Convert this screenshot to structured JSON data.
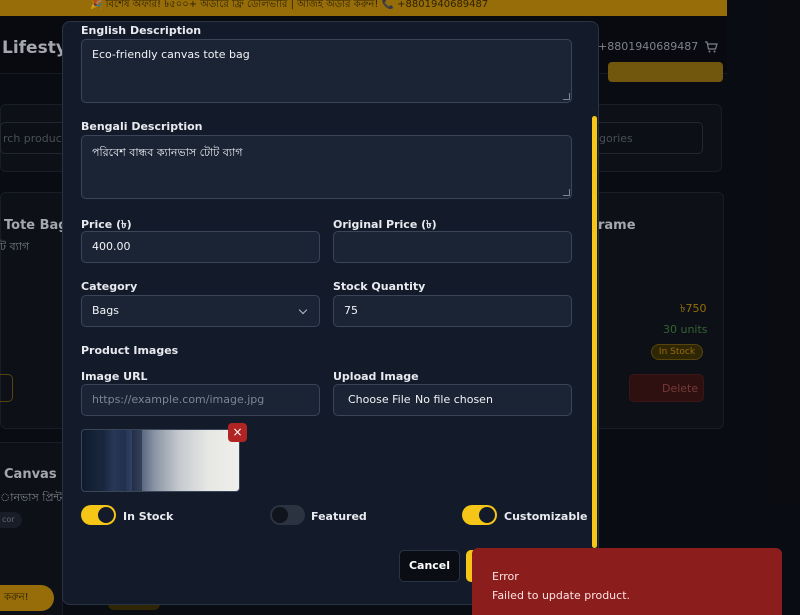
{
  "background": {
    "promo_text": "🎉 বিশেষ অফার! ৳৫০০+ অর্ডারে ফ্রি ডেলিভারি | আজই অর্ডার করুন! 📞 +8801940689487",
    "brand": "Lifesty",
    "header_phone": "+8801940689487",
    "search_placeholder": "rch products",
    "category_select": "gories",
    "card1_title": "Tote Bag",
    "card1_subtitle": "ট ব্যাগ",
    "card2_title": "rame",
    "card2_price": "৳750",
    "card2_units": "30 units",
    "card2_badge": "In Stock",
    "card2_delete": "Delete",
    "card3_title": "Canvas P",
    "card3_subtitle": "ানভাস প্রিন্ট",
    "card3_tag": "cor",
    "cta_text": "করুন!"
  },
  "form": {
    "english_description": {
      "label": "English Description",
      "value": "Eco-friendly canvas tote bag"
    },
    "bengali_description": {
      "label": "Bengali Description",
      "value": "পরিবেশ বান্ধব ক্যানভাস টোট ব্যাগ"
    },
    "price": {
      "label": "Price (৳)",
      "value": "400.00"
    },
    "original_price": {
      "label": "Original Price (৳)",
      "value": ""
    },
    "category": {
      "label": "Category",
      "value": "Bags"
    },
    "stock_quantity": {
      "label": "Stock Quantity",
      "value": "75"
    },
    "product_images": {
      "label": "Product Images"
    },
    "image_url": {
      "label": "Image URL",
      "placeholder": "https://example.com/image.jpg"
    },
    "upload_image": {
      "label": "Upload Image",
      "button": "Choose File",
      "status": "No file chosen"
    },
    "remove_image": "×",
    "toggles": [
      {
        "label": "In Stock",
        "on": true
      },
      {
        "label": "Featured",
        "on": false
      },
      {
        "label": "Customizable",
        "on": true
      }
    ],
    "cancel_label": "Cancel"
  },
  "toast": {
    "title": "Error",
    "message": "Failed to update product."
  },
  "colors": {
    "accent": "#f5c518",
    "modal_bg": "#131b2b",
    "toast_error": "#8b1d1d"
  }
}
